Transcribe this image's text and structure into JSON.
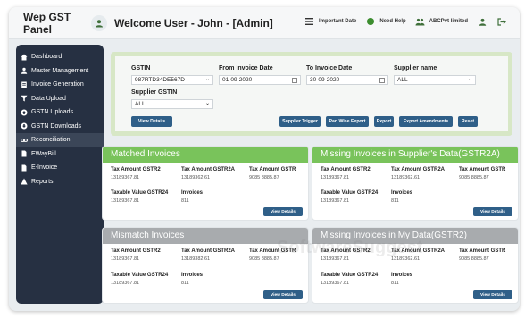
{
  "header": {
    "app_title": "Wep GST Panel",
    "welcome": "Welcome User - John - [Admin]",
    "important_date": "Important Date",
    "need_help": "Need Help",
    "company": "ABCPvt limited"
  },
  "sidebar": {
    "items": [
      {
        "label": "Dashboard",
        "icon": "home-icon"
      },
      {
        "label": "Master Management",
        "icon": "user-icon"
      },
      {
        "label": "Invoice Generation",
        "icon": "document-icon"
      },
      {
        "label": "Data Upload",
        "icon": "filter-icon"
      },
      {
        "label": "GSTN Uploads",
        "icon": "upload-icon"
      },
      {
        "label": "GSTN Downloads",
        "icon": "download-icon"
      },
      {
        "label": "Reconciliation",
        "icon": "link-icon"
      },
      {
        "label": "EWayBill",
        "icon": "file-icon"
      },
      {
        "label": "E-Invoice",
        "icon": "file-icon"
      },
      {
        "label": "Reports",
        "icon": "warning-icon"
      }
    ],
    "active_item": "Reconciliation"
  },
  "filters": {
    "gstin_label": "GSTIN",
    "gstin_value": "987RTD34DE567D",
    "from_label": "From Invoice Date",
    "from_value": "01-09-2020",
    "to_label": "To Invoice Date",
    "to_value": "30-09-2020",
    "supplier_name_label": "Supplier name",
    "supplier_name_value": "ALL",
    "supplier_gstin_label": "Supplier GSTIN",
    "supplier_gstin_value": "ALL",
    "buttons": {
      "view_details": "View Details",
      "supplier_trigger": "Supplier Trigger",
      "pan_wise_export": "Pan Wise Export",
      "export": "Export",
      "export_amendments": "Export Amendments",
      "reset": "Reset"
    }
  },
  "cards": {
    "matched": {
      "title": "Matched Invoices",
      "tax_gstr2_label": "Tax Amount GSTR2",
      "tax_gstr2_value": "13189367.81",
      "tax_gstr2a_label": "Tax Amount GSTR2A",
      "tax_gstr2a_value": "13189362.61",
      "third_label": "Tax Amount GSTR",
      "third_value": "9085 8885.87",
      "taxable_label": "Taxable Value GSTR24",
      "taxable_value": "13189367.81",
      "invoices_label": "Invoices",
      "invoices_value": "811",
      "button": "View Details"
    },
    "missing_supplier": {
      "title": "Missing Invoices in Supplier's Data(GSTR2A)",
      "tax_gstr2_label": "Tax Amount GSTR2",
      "tax_gstr2_value": "13189367.81",
      "tax_gstr2a_label": "Tax Amount GSTR2A",
      "tax_gstr2a_value": "13189362.61",
      "third_label": "Tax Amount GSTR",
      "third_value": "9085 8885.87",
      "taxable_label": "Taxable Value GSTR24",
      "taxable_value": "13189367.81",
      "invoices_label": "Invoices",
      "invoices_value": "811",
      "button": "View Details"
    },
    "mismatch": {
      "title": "Mismatch Invoices",
      "tax_gstr2_label": "Tax Amount GSTR2",
      "tax_gstr2_value": "13189367.81",
      "tax_gstr2a_label": "Tax Amount GSTR2A",
      "tax_gstr2a_value": "13189382.61",
      "third_label": "Tax Amount GSTR",
      "third_value": "9085 8885.87",
      "taxable_label": "Taxable Value GSTR24",
      "taxable_value": "13189367.81",
      "invoices_label": "Invoices",
      "invoices_value": "811",
      "button": "View Details"
    },
    "missing_my": {
      "title": "Missing Invoices in My Data(GSTR2)",
      "tax_gstr2_label": "Tax Amount GSTR2",
      "tax_gstr2_value": "13189367.81",
      "tax_gstr2a_label": "Tax Amount GSTR2A",
      "tax_gstr2a_value": "13189362.61",
      "third_label": "Tax Amount GSTR",
      "third_value": "9085 8885.87",
      "taxable_label": "Taxable Value GSTR24",
      "taxable_value": "13189367.81",
      "invoices_label": "Invoices",
      "invoices_value": "811",
      "button": "View Details"
    }
  },
  "watermark": "SoftwareSuggest",
  "colors": {
    "sidebar_bg": "#263042",
    "accent_button": "#2f5f88",
    "matched_header": "#79c35b",
    "grey_header": "#a8abae",
    "filter_border": "#d7e7c6"
  }
}
